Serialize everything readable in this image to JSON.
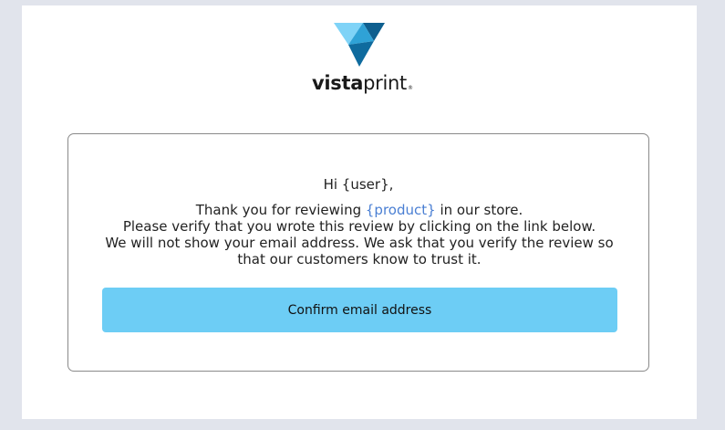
{
  "brand": {
    "logo_icon": "vistaprint-triangle-logo-icon",
    "wordmark_bold": "vista",
    "wordmark_light": "print",
    "registered_mark": "®",
    "colors": {
      "light_blue": "#6dcdf5",
      "mid_blue": "#2fa2d6",
      "dark_blue": "#0f6b9e"
    }
  },
  "email": {
    "greeting": "Hi {user},",
    "body_line1_prefix": "Thank you for reviewing ",
    "product_placeholder": "{product}",
    "body_line1_suffix": " in our store.",
    "body_line2": "Please verify that you wrote this review by clicking on the link below.",
    "body_line3": "We will not show your email address. We ask that you verify the review so",
    "body_line4": "that our customers know to trust it.",
    "confirm_button_label": "Confirm email address"
  },
  "colors": {
    "page_background": "#e1e4ec",
    "canvas_background": "#ffffff",
    "button_background": "#6dcdf5",
    "link_color": "#4a7fd3",
    "text_color": "#222222"
  }
}
